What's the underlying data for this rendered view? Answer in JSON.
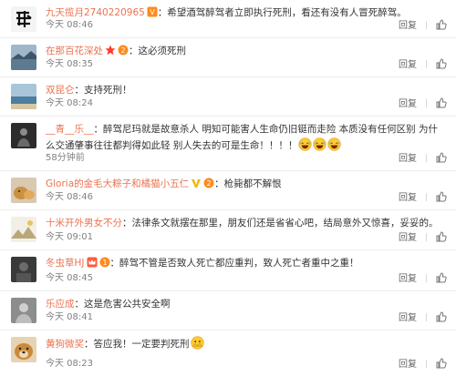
{
  "comments": [
    {
      "user": "九天揽月2740220965",
      "badges": [
        "vip-badge-icon"
      ],
      "text": "：希望酒驾醉驾者立即执行死刑，看还有没有人冒死醉驾。",
      "time": "今天 08:46",
      "reply": "回复",
      "avatar": "calligraphy-avatar"
    },
    {
      "user": "在那百花深处",
      "badges": [
        "star-badge-icon",
        "vip-badge-icon"
      ],
      "text": "：这必须死刑",
      "time": "今天 08:35",
      "reply": "回复",
      "avatar": "lake-avatar"
    },
    {
      "user": "双昆仑",
      "badges": [],
      "text": "：支持死刑！",
      "time": "今天 08:24",
      "reply": "回复",
      "avatar": "sea-avatar"
    },
    {
      "user": "__青__乐__",
      "badges": [],
      "text": "：醉驾尼玛就是故意杀人 明知可能害人生命仍旧铤而走险 本质没有任何区别 为什么交通肇事往往都判得如此轻 别人失去的可是生命！！！！",
      "emoji_count": 3,
      "time": "58分钟前",
      "reply": "回复",
      "avatar": "figure-avatar"
    },
    {
      "user": "Gloria的金毛大粽子和橘猫小五仁",
      "badges": [
        "v-badge-icon",
        "vip-badge-icon"
      ],
      "text": "：枪毙都不解恨",
      "time": "今天 08:46",
      "reply": "回复",
      "avatar": "pet-avatar"
    },
    {
      "user": "十米开外男女不分",
      "badges": [],
      "text": "：法律条文就摆在那里，朋友们还是省省心吧，结局意外又惊喜，妥妥的。",
      "time": "今天 09:01",
      "reply": "回复",
      "avatar": "mountain-avatar"
    },
    {
      "user": "冬虫草HJ",
      "badges": [
        "crown-badge-icon",
        "vip-badge-icon"
      ],
      "text": "：醉驾不管是否致人死亡都应重判，致人死亡者重中之重！",
      "time": "今天 08:45",
      "reply": "回复",
      "avatar": "dark-avatar"
    },
    {
      "user": "乐应成",
      "badges": [],
      "text": "：这是危害公共安全啊",
      "time": "今天 08:41",
      "reply": "回复",
      "avatar": "gray-avatar"
    },
    {
      "user": "黄狗微奖",
      "badges": [],
      "text": "：答应我！一定要判死刑",
      "emoji_count": 1,
      "time": "今天 08:23",
      "reply": "回复",
      "avatar": "dog-avatar"
    }
  ],
  "colors": {
    "username": "#eb7350",
    "text": "#333333",
    "meta": "#808080"
  }
}
